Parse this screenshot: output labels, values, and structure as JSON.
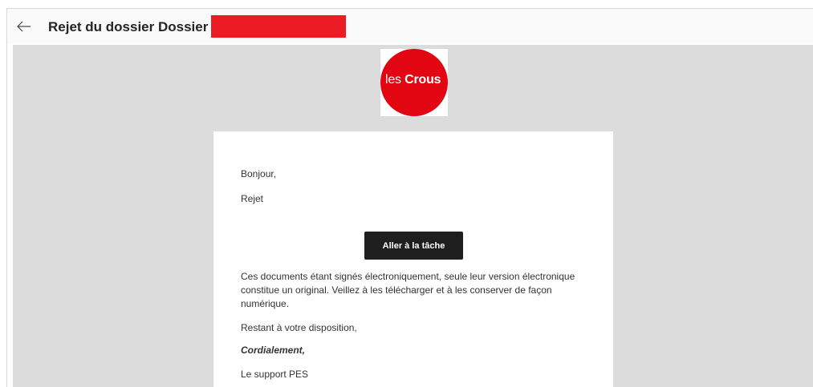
{
  "header": {
    "title": "Rejet du dossier Dossier",
    "back_icon": "arrow-left-icon"
  },
  "logo": {
    "prefix": "les",
    "brand": "Crous",
    "color": "#e20613"
  },
  "email": {
    "greeting": "Bonjour,",
    "message": "Rejet",
    "button_label": "Aller à la tâche",
    "paragraph": "Ces documents étant signés électroniquement, seule leur version électronique constitue un original. Veillez à les télécharger et à les conserver de façon numérique.",
    "closing": "Restant à votre disposition,",
    "signoff": "Cordialement,",
    "signature": "Le support PES"
  },
  "colors": {
    "redaction": "#ec1c24",
    "background": "#dcdcdc",
    "button": "#1e1e1e"
  }
}
